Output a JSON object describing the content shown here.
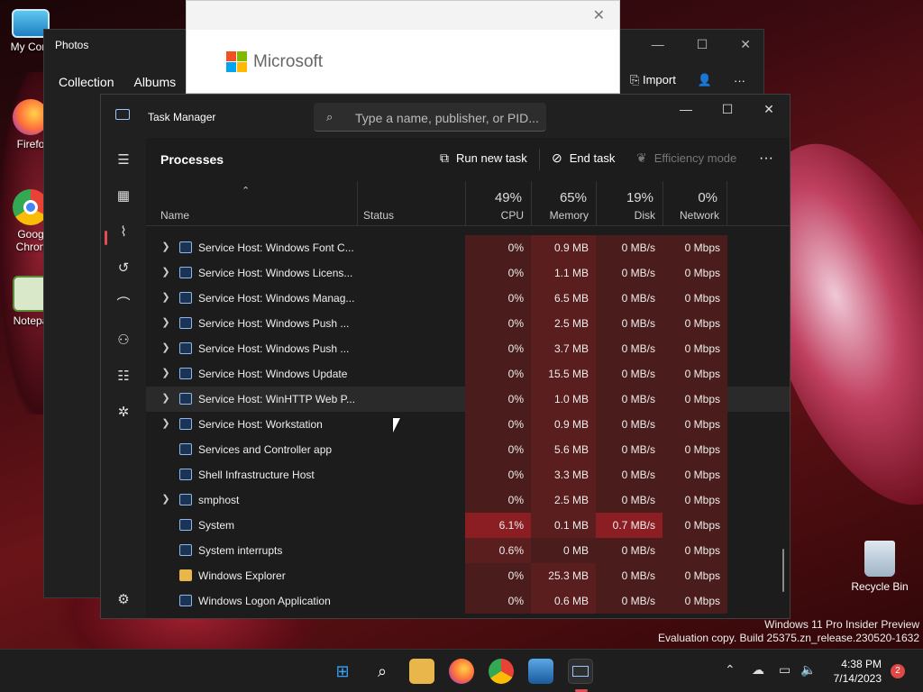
{
  "desktop": {
    "icons": [
      {
        "label": "My Com",
        "icon": "computer-icon"
      },
      {
        "label": "Firefo",
        "icon": "firefox-icon"
      },
      {
        "label": "Goog Chron",
        "icon": "chrome-icon"
      },
      {
        "label": "Notepa",
        "icon": "notepad-icon"
      }
    ],
    "recycle_bin": "Recycle Bin",
    "watermark_line1": "Windows 11 Pro Insider Preview",
    "watermark_line2": "Evaluation copy. Build 25375.zn_release.230520-1632"
  },
  "photos": {
    "title": "Photos",
    "nav": [
      "Collection",
      "Albums"
    ],
    "import_label": "Import",
    "ms_brand": "Microsoft"
  },
  "taskmanager": {
    "title": "Task Manager",
    "search_placeholder": "Type a name, publisher, or PID...",
    "page_title": "Processes",
    "run_new_task": "Run new task",
    "end_task": "End task",
    "efficiency_mode": "Efficiency mode",
    "columns": {
      "name": "Name",
      "status": "Status",
      "cpu_pct": "49%",
      "cpu": "CPU",
      "mem_pct": "65%",
      "mem": "Memory",
      "disk_pct": "19%",
      "disk": "Disk",
      "net_pct": "0%",
      "net": "Network"
    },
    "rows": [
      {
        "name": "Service Host: Windows Font C...",
        "cpu": "0%",
        "mem": "0.9 MB",
        "disk": "0 MB/s",
        "net": "0 Mbps",
        "expand": true
      },
      {
        "name": "Service Host: Windows Licens...",
        "cpu": "0%",
        "mem": "1.1 MB",
        "disk": "0 MB/s",
        "net": "0 Mbps",
        "expand": true
      },
      {
        "name": "Service Host: Windows Manag...",
        "cpu": "0%",
        "mem": "6.5 MB",
        "disk": "0 MB/s",
        "net": "0 Mbps",
        "expand": true
      },
      {
        "name": "Service Host: Windows Push ...",
        "cpu": "0%",
        "mem": "2.5 MB",
        "disk": "0 MB/s",
        "net": "0 Mbps",
        "expand": true
      },
      {
        "name": "Service Host: Windows Push ...",
        "cpu": "0%",
        "mem": "3.7 MB",
        "disk": "0 MB/s",
        "net": "0 Mbps",
        "expand": true
      },
      {
        "name": "Service Host: Windows Update",
        "cpu": "0%",
        "mem": "15.5 MB",
        "disk": "0 MB/s",
        "net": "0 Mbps",
        "expand": true
      },
      {
        "name": "Service Host: WinHTTP Web P...",
        "cpu": "0%",
        "mem": "1.0 MB",
        "disk": "0 MB/s",
        "net": "0 Mbps",
        "expand": true
      },
      {
        "name": "Service Host: Workstation",
        "cpu": "0%",
        "mem": "0.9 MB",
        "disk": "0 MB/s",
        "net": "0 Mbps",
        "expand": true
      },
      {
        "name": "Services and Controller app",
        "cpu": "0%",
        "mem": "5.6 MB",
        "disk": "0 MB/s",
        "net": "0 Mbps",
        "expand": false
      },
      {
        "name": "Shell Infrastructure Host",
        "cpu": "0%",
        "mem": "3.3 MB",
        "disk": "0 MB/s",
        "net": "0 Mbps",
        "expand": false
      },
      {
        "name": "smphost",
        "cpu": "0%",
        "mem": "2.5 MB",
        "disk": "0 MB/s",
        "net": "0 Mbps",
        "expand": true
      },
      {
        "name": "System",
        "cpu": "6.1%",
        "mem": "0.1 MB",
        "disk": "0.7 MB/s",
        "net": "0 Mbps",
        "expand": false
      },
      {
        "name": "System interrupts",
        "cpu": "0.6%",
        "mem": "0 MB",
        "disk": "0 MB/s",
        "net": "0 Mbps",
        "expand": false
      },
      {
        "name": "Windows Explorer",
        "cpu": "0%",
        "mem": "25.3 MB",
        "disk": "0 MB/s",
        "net": "0 Mbps",
        "expand": false,
        "folder": true
      },
      {
        "name": "Windows Logon Application",
        "cpu": "0%",
        "mem": "0.6 MB",
        "disk": "0 MB/s",
        "net": "0 Mbps",
        "expand": false
      }
    ]
  },
  "taskbar": {
    "time": "4:38 PM",
    "date": "7/14/2023",
    "notification_count": "2"
  },
  "colors": {
    "heat_low": "#4a1c1c",
    "heat_mid": "#5a1e1e",
    "heat_high": "#8a1e22",
    "accent": "#e04d56"
  }
}
